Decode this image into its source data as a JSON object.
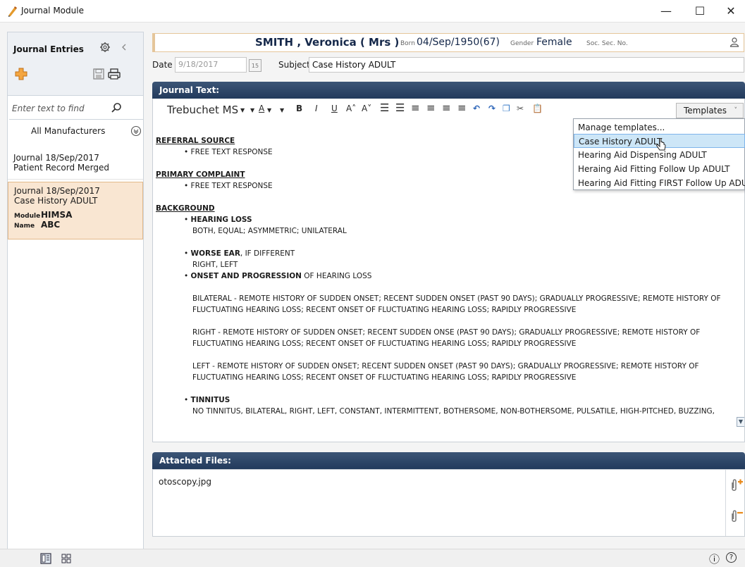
{
  "window": {
    "title": "Journal Module",
    "minimize": "—",
    "maximize": "☐",
    "close": "✕"
  },
  "sidebar": {
    "title": "Journal Entries",
    "search_placeholder": "Enter text to find",
    "manufacturer": "All Manufacturers",
    "entries": [
      {
        "line1": "Journal  18/Sep/2017",
        "line2": "Patient Record Merged"
      },
      {
        "line1": "Journal  18/Sep/2017",
        "line2": "Case History ADULT",
        "module_label": "Module",
        "module_value": "HIMSA",
        "name_label": "Name",
        "name_value": "ABC"
      }
    ]
  },
  "patient": {
    "name": "SMITH , Veronica  ( Mrs )",
    "born_label": "Born",
    "born_value": "04/Sep/1950(67)",
    "gender_label": "Gender",
    "gender_value": "Female",
    "ssn_label": "Soc. Sec. No."
  },
  "form": {
    "date_label": "Date",
    "date_value": "9/18/2017",
    "calendar": "15",
    "subject_label": "Subject",
    "subject_value": "Case History ADULT"
  },
  "journal": {
    "section_title": "Journal Text:",
    "font_name": "Trebuchet MS"
  },
  "templates": {
    "button_label": "Templates",
    "items": [
      "Manage templates...",
      "Case History ADULT",
      "Hearing Aid Dispensing ADULT",
      "Heraing Aid Fitting Follow Up ADULT",
      "Hearing Aid Fitting FIRST Follow Up ADULT"
    ]
  },
  "document": {
    "referral_heading": "REFERRAL SOURCE",
    "referral_item": "FREE TEXT RESPONSE",
    "primary_heading": "PRIMARY COMPLAINT",
    "primary_item": "FREE TEXT RESPONSE",
    "background_heading": "BACKGROUND",
    "hearing_loss_title": "HEARING LOSS",
    "hearing_loss_opts": "BOTH, EQUAL; ASYMMETRIC; UNILATERAL",
    "worse_ear_title": "WORSE EAR",
    "worse_ear_suffix": ", IF DIFFERENT",
    "worse_ear_opts": "RIGHT, LEFT",
    "onset_title": "ONSET AND PROGRESSION",
    "onset_suffix": " OF HEARING LOSS",
    "bilateral": "BILATERAL - REMOTE HISTORY OF SUDDEN ONSET; RECENT SUDDEN ONSET (PAST 90 DAYS); GRADUALLY PROGRESSIVE; REMOTE HISTORY OF FLUCTUATING HEARING LOSS; RECENT ONSET OF FLUCTUATING HEARING LOSS; RAPIDLY PROGRESSIVE",
    "right": "RIGHT - REMOTE HISTORY OF SUDDEN ONSET; RECENT SUDDEN ONSE (PAST 90 DAYS); GRADUALLY PROGRESSIVE; REMOTE HISTORY OF FLUCTUATING HEARING LOSS; RECENT ONSET OF FLUCTUATING HEARING LOSS; RAPIDLY PROGRESSIVE",
    "left": "LEFT - REMOTE HISTORY OF SUDDEN ONSET; RECENT SUDDEN ONSET (PAST 90 DAYS); GRADUALLY PROGRESSIVE; REMOTE HISTORY OF FLUCTUATING HEARING LOSS; RECENT ONSET OF FLUCTUATING HEARING LOSS; RAPIDLY PROGRESSIVE",
    "tinnitus_title": "TINNITUS",
    "tinnitus_opts": "NO TINNITUS, BILATERAL, RIGHT, LEFT, CONSTANT, INTERMITTENT, BOTHERSOME, NON-BOTHERSOME, PULSATILE, HIGH-PITCHED, BUZZING,"
  },
  "attachments": {
    "section_title": "Attached Files:",
    "files": [
      "otoscopy.jpg"
    ]
  },
  "status": {
    "info": "ⓘ",
    "help": "?"
  },
  "colors": {
    "section_bar": "#223a5c",
    "selected_entry": "#f9e6d2",
    "accent_orange": "#e8891a",
    "menu_selected": "#cde6f7"
  }
}
